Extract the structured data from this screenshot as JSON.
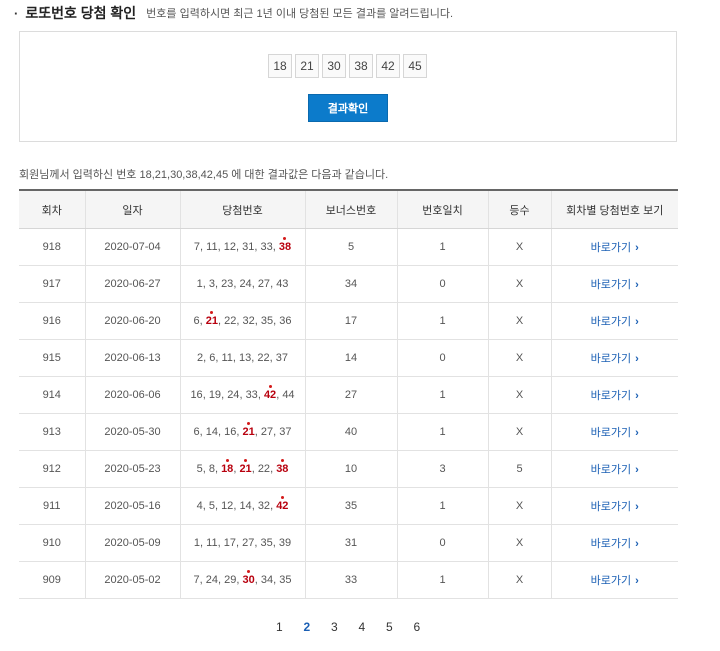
{
  "header": {
    "bullet": "·",
    "title": "로또번호 당첨 확인",
    "description": "번호를 입력하시면 최근 1년 이내 당첨된 모든 결과를 알려드립니다."
  },
  "input": {
    "numbers": [
      "18",
      "21",
      "30",
      "38",
      "42",
      "45"
    ],
    "button_label": "결과확인"
  },
  "summary": "회원님께서 입력하신 번호 18,21,30,38,42,45 에 대한 결과값은 다음과 같습니다.",
  "table": {
    "columns": [
      "회차",
      "일자",
      "당첨번호",
      "보너스번호",
      "번호일치",
      "등수",
      "회차별 당첨번호 보기"
    ],
    "link_label": "바로가기",
    "rows": [
      {
        "round": "918",
        "date": "2020-07-04",
        "numbers": [
          "7",
          "11",
          "12",
          "31",
          "33",
          "38"
        ],
        "hits": [
          "38"
        ],
        "bonus": "5",
        "matches": "1",
        "rank": "X"
      },
      {
        "round": "917",
        "date": "2020-06-27",
        "numbers": [
          "1",
          "3",
          "23",
          "24",
          "27",
          "43"
        ],
        "hits": [],
        "bonus": "34",
        "matches": "0",
        "rank": "X"
      },
      {
        "round": "916",
        "date": "2020-06-20",
        "numbers": [
          "6",
          "21",
          "22",
          "32",
          "35",
          "36"
        ],
        "hits": [
          "21"
        ],
        "bonus": "17",
        "matches": "1",
        "rank": "X"
      },
      {
        "round": "915",
        "date": "2020-06-13",
        "numbers": [
          "2",
          "6",
          "11",
          "13",
          "22",
          "37"
        ],
        "hits": [],
        "bonus": "14",
        "matches": "0",
        "rank": "X"
      },
      {
        "round": "914",
        "date": "2020-06-06",
        "numbers": [
          "16",
          "19",
          "24",
          "33",
          "42",
          "44"
        ],
        "hits": [
          "42"
        ],
        "bonus": "27",
        "matches": "1",
        "rank": "X"
      },
      {
        "round": "913",
        "date": "2020-05-30",
        "numbers": [
          "6",
          "14",
          "16",
          "21",
          "27",
          "37"
        ],
        "hits": [
          "21"
        ],
        "bonus": "40",
        "matches": "1",
        "rank": "X"
      },
      {
        "round": "912",
        "date": "2020-05-23",
        "numbers": [
          "5",
          "8",
          "18",
          "21",
          "22",
          "38"
        ],
        "hits": [
          "18",
          "21",
          "38"
        ],
        "bonus": "10",
        "matches": "3",
        "rank": "5"
      },
      {
        "round": "911",
        "date": "2020-05-16",
        "numbers": [
          "4",
          "5",
          "12",
          "14",
          "32",
          "42"
        ],
        "hits": [
          "42"
        ],
        "bonus": "35",
        "matches": "1",
        "rank": "X"
      },
      {
        "round": "910",
        "date": "2020-05-09",
        "numbers": [
          "1",
          "11",
          "17",
          "27",
          "35",
          "39"
        ],
        "hits": [],
        "bonus": "31",
        "matches": "0",
        "rank": "X"
      },
      {
        "round": "909",
        "date": "2020-05-02",
        "numbers": [
          "7",
          "24",
          "29",
          "30",
          "34",
          "35"
        ],
        "hits": [
          "30"
        ],
        "bonus": "33",
        "matches": "1",
        "rank": "X"
      }
    ]
  },
  "pagination": {
    "pages": [
      "1",
      "2",
      "3",
      "4",
      "5",
      "6"
    ],
    "current": "2"
  },
  "colors": {
    "accent": "#0c7bcb",
    "link": "#1a5fb4",
    "hit": "#b8000e"
  }
}
